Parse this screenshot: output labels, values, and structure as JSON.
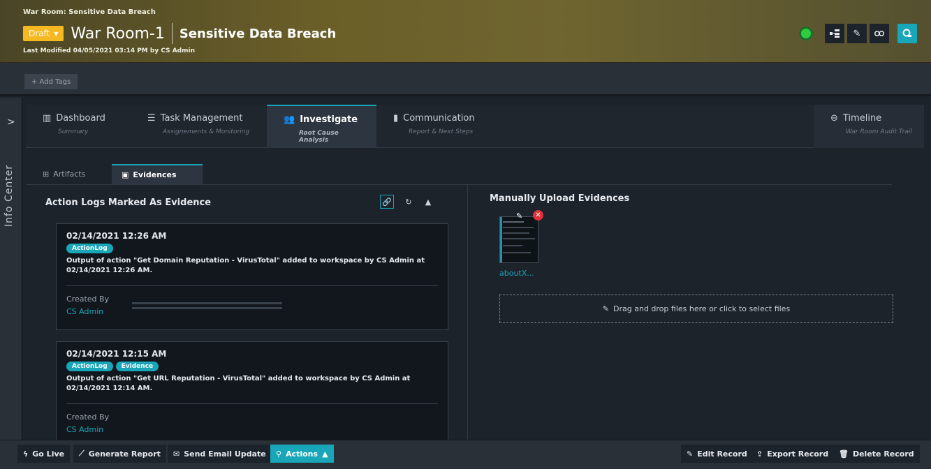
{
  "header": {
    "breadcrumb": "War Room: Sensitive Data Breach",
    "status": "Draft",
    "title": "War Room-1",
    "subtitle": "Sensitive Data Breach",
    "last_modified": "Last Modified 04/05/2021 03:14 PM by CS Admin",
    "status_color": "#2ecc40"
  },
  "tagbar": {
    "add_tags": "+ Add Tags"
  },
  "sidebar": {
    "label": "Info Center",
    "expand": ">"
  },
  "tabs": [
    {
      "label": "Dashboard",
      "sub": "Summary",
      "icon": "bar-chart-icon"
    },
    {
      "label": "Task Management",
      "sub": "Assignements & Monitoring",
      "icon": "list-icon"
    },
    {
      "label": "Investigate",
      "sub": "Root Cause Analysis",
      "icon": "users-icon",
      "active": true
    },
    {
      "label": "Communication",
      "sub": "Report & Next Steps",
      "icon": "chart-icon"
    },
    {
      "label": "Timeline",
      "sub": "War Room Audit Trail",
      "icon": "timeline-icon"
    }
  ],
  "subtabs": [
    {
      "label": "Artifacts",
      "icon": "artifacts-icon"
    },
    {
      "label": "Evidences",
      "icon": "evidence-icon",
      "active": true
    }
  ],
  "left_pane": {
    "title": "Action Logs Marked As Evidence",
    "cards": [
      {
        "date": "02/14/2021 12:26 AM",
        "tags": [
          "ActionLog"
        ],
        "message": "Output of action \"Get Domain Reputation - VirusTotal\" added to workspace by CS Admin at 02/14/2021 12:26 AM.",
        "created_by_label": "Created By",
        "created_by": "CS Admin"
      },
      {
        "date": "02/14/2021 12:15 AM",
        "tags": [
          "ActionLog",
          "Evidence"
        ],
        "message": "Output of action \"Get URL Reputation - VirusTotal\" added to workspace by CS Admin at 02/14/2021 12:14 AM.",
        "created_by_label": "Created By",
        "created_by": "CS Admin"
      }
    ]
  },
  "right_pane": {
    "title": "Manually Upload Evidences",
    "file_name": "aboutX...",
    "drop_text": "Drag and drop files here or click to select files"
  },
  "footer": {
    "go_live": "Go Live",
    "generate_report": "Generate Report",
    "send_email": "Send Email Update",
    "actions": "Actions",
    "edit_record": "Edit Record",
    "export_record": "Export Record",
    "delete_record": "Delete Record"
  },
  "colors": {
    "accent": "#19a6b8",
    "draft": "#f4b820",
    "danger": "#e0313b"
  }
}
